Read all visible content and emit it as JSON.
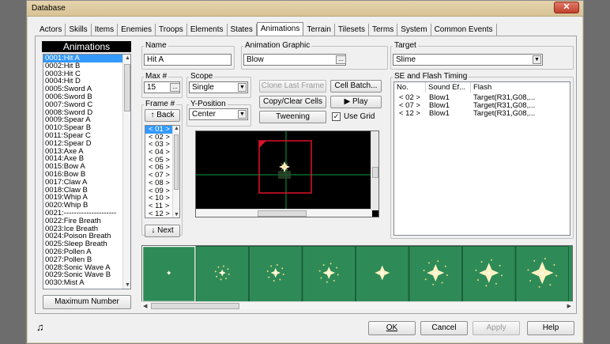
{
  "window": {
    "title": "Database",
    "close_glyph": "✕"
  },
  "tabs": [
    {
      "label": "Actors"
    },
    {
      "label": "Skills"
    },
    {
      "label": "Items"
    },
    {
      "label": "Enemies"
    },
    {
      "label": "Troops"
    },
    {
      "label": "Elements"
    },
    {
      "label": "States"
    },
    {
      "label": "Animations"
    },
    {
      "label": "Terrain"
    },
    {
      "label": "Tilesets"
    },
    {
      "label": "Terms"
    },
    {
      "label": "System"
    },
    {
      "label": "Common Events"
    }
  ],
  "animation_list": {
    "header": "Animations",
    "items": [
      "0001:Hit A",
      "0002:Hit B",
      "0003:Hit C",
      "0004:Hit D",
      "0005:Sword A",
      "0006:Sword B",
      "0007:Sword C",
      "0008:Sword D",
      "0009:Spear A",
      "0010:Spear B",
      "0011:Spear C",
      "0012:Spear D",
      "0013:Axe A",
      "0014:Axe B",
      "0015:Bow A",
      "0016:Bow B",
      "0017:Claw A",
      "0018:Claw B",
      "0019:Whip A",
      "0020:Whip B",
      "0021:---------------------",
      "0022:Fire Breath",
      "0023:Ice Breath",
      "0024:Poison Breath",
      "0025:Sleep Breath",
      "0026:Pollen A",
      "0027:Pollen B",
      "0028:Sonic Wave A",
      "0029:Sonic Wave B",
      "0030:Mist A"
    ],
    "maximum_button": "Maximum Number"
  },
  "name": {
    "label": "Name",
    "value": "Hit A"
  },
  "animation_graphic": {
    "label": "Animation Graphic",
    "value": "Blow",
    "ellipsis": "..."
  },
  "target": {
    "label": "Target",
    "value": "Slime"
  },
  "max": {
    "label": "Max #",
    "value": "15",
    "ellipsis": "..."
  },
  "scope": {
    "label": "Scope",
    "value": "Single"
  },
  "buttons": {
    "clone_last_frame": "Clone Last Frame",
    "cell_batch": "Cell Batch...",
    "copy_clear_cells": "Copy/Clear Cells",
    "play": "▶ Play",
    "tweening": "Tweening",
    "use_grid": "Use Grid",
    "back": "↑ Back",
    "next": "↓ Next"
  },
  "use_grid_checked": true,
  "frame": {
    "label": "Frame #",
    "items": [
      "< 01 >",
      "< 02 >",
      "< 03 >",
      "< 04 >",
      "< 05 >",
      "< 06 >",
      "< 07 >",
      "< 08 >",
      "< 09 >",
      "< 10 >",
      "< 11 >",
      "< 12 >"
    ]
  },
  "y_position": {
    "label": "Y-Position",
    "value": "Center"
  },
  "se_flash": {
    "label": "SE and Flash Timing",
    "columns": [
      "No.",
      "Sound Ef...",
      "Flash"
    ],
    "rows": [
      {
        "no": "< 02 >",
        "sound": "Blow1",
        "flash": "Target(R31,G08,..."
      },
      {
        "no": "< 07 >",
        "sound": "Blow1",
        "flash": "Target(R31,G08,..."
      },
      {
        "no": "< 12 >",
        "sound": "Blow1",
        "flash": "Target(R31,G08,..."
      }
    ]
  },
  "strip": {
    "cell_count": 8,
    "background": "#2e8b57"
  },
  "footer": {
    "ok": "OK",
    "cancel": "Cancel",
    "apply": "Apply",
    "help": "Help",
    "music_icon": "♫"
  },
  "colors": {
    "selection": "#3399ff",
    "frame_border": "#e0102a",
    "grid": "#00a040"
  }
}
